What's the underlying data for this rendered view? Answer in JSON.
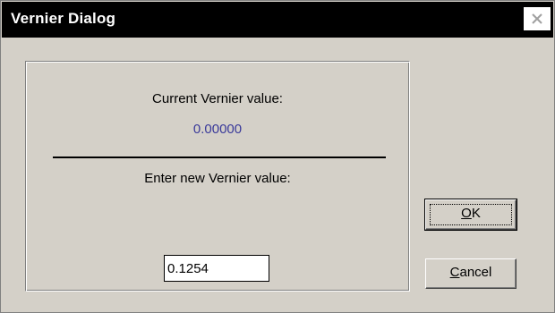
{
  "window": {
    "title": "Vernier Dialog",
    "close_glyph": "×"
  },
  "panel": {
    "current_label": "Current Vernier value:",
    "current_value": "0.00000",
    "enter_label": "Enter new Vernier value:",
    "input_value": "0.1254"
  },
  "buttons": {
    "ok_mnemonic": "O",
    "ok_rest": "K",
    "cancel_mnemonic": "C",
    "cancel_rest": "ancel"
  },
  "colors": {
    "titlebar": "#000000",
    "dialog_bg": "#d4d0c8",
    "value_text": "#3a3a9a"
  },
  "icons": {
    "close": "close-icon"
  }
}
